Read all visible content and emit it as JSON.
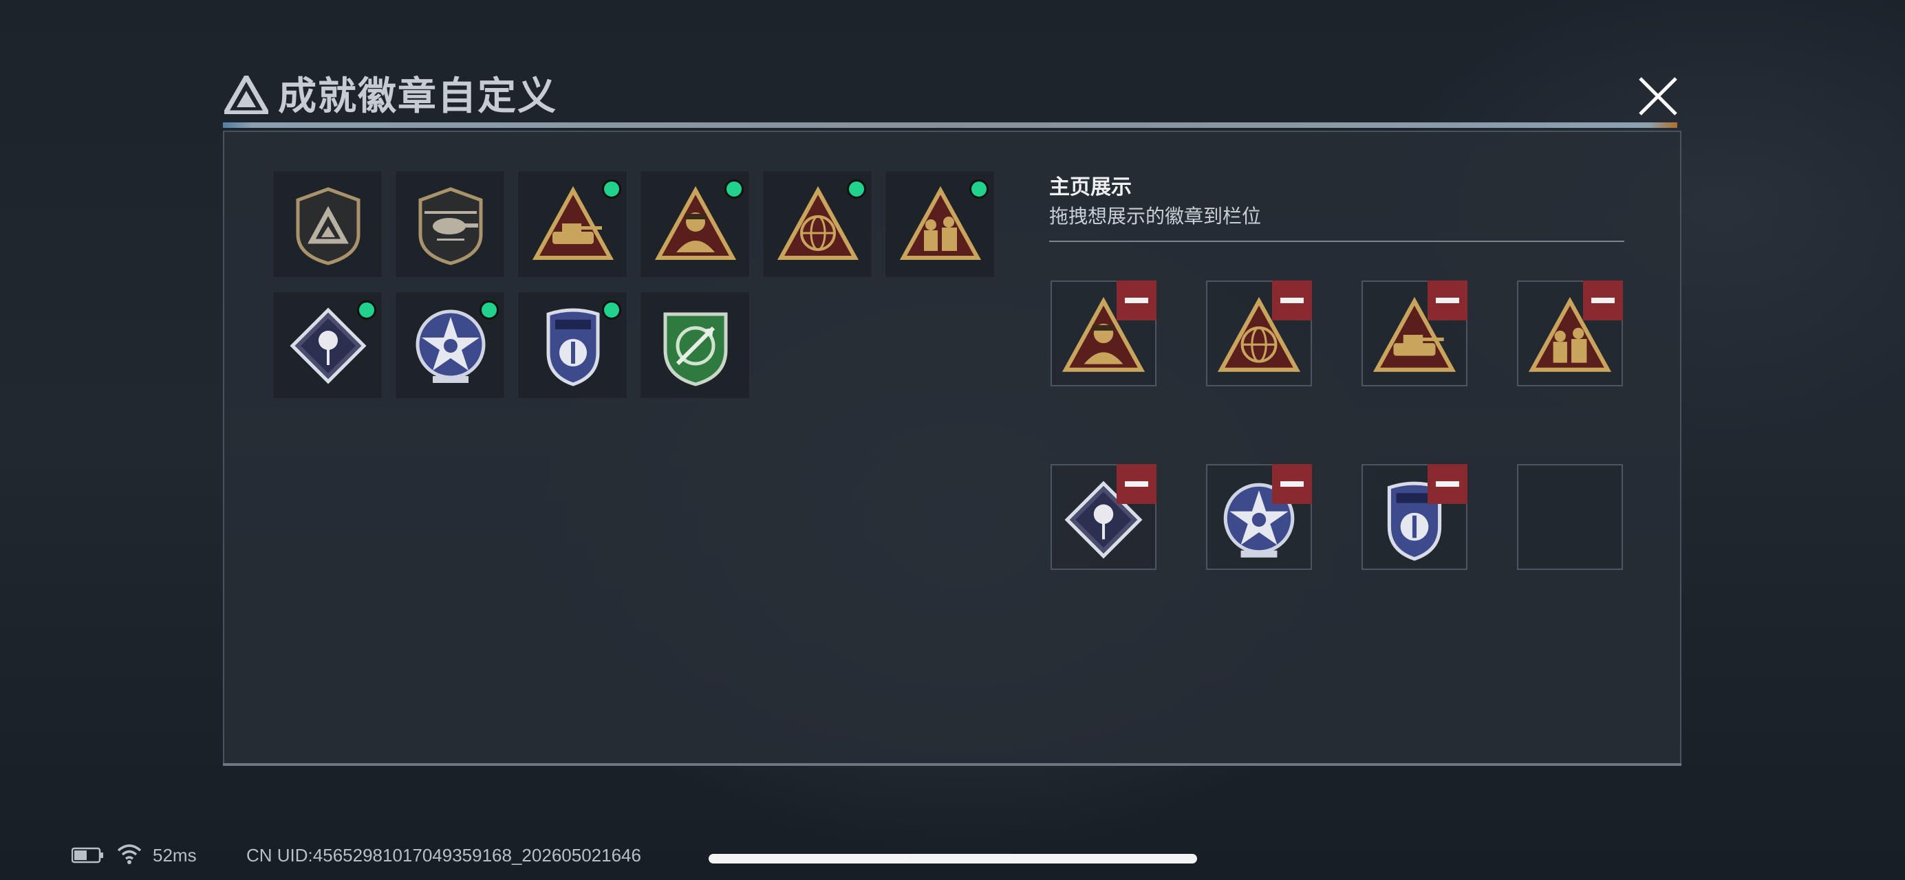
{
  "window": {
    "title": "成就徽章自定义"
  },
  "colors": {
    "accent_green": "#21d28c",
    "remove_red": "#8a2a2e",
    "badge_gold": "#c9a45c",
    "badge_blue": "#3d4a8c",
    "badge_green": "#2f7a3e"
  },
  "badge_grid": [
    {
      "icon": "basic-triangle-shield-badge-icon",
      "equipped": false
    },
    {
      "icon": "helicopter-shield-badge-icon",
      "equipped": false
    },
    {
      "icon": "vehicle-triangle-badge-icon",
      "equipped": true
    },
    {
      "icon": "soldier-triangle-badge-icon",
      "equipped": true
    },
    {
      "icon": "eri-globe-triangle-badge-icon",
      "equipped": true
    },
    {
      "icon": "squad-triangle-badge-icon",
      "equipped": true
    },
    {
      "icon": "rose-diamond-badge-icon",
      "equipped": true
    },
    {
      "icon": "star-medallion-badge-icon",
      "equipped": true
    },
    {
      "icon": "police-shield-badge-icon",
      "equipped": true
    },
    {
      "icon": "green-arrows-shield-badge-icon",
      "equipped": false
    }
  ],
  "showcase": {
    "title": "主页展示",
    "subtitle": "拖拽想展示的徽章到栏位",
    "slots": [
      {
        "icon": "soldier-triangle-badge-icon"
      },
      {
        "icon": "eri-globe-triangle-badge-icon"
      },
      {
        "icon": "vehicle-triangle-badge-icon"
      },
      {
        "icon": "squad-triangle-badge-icon"
      },
      {
        "icon": "rose-diamond-badge-icon"
      },
      {
        "icon": "star-medallion-badge-icon"
      },
      {
        "icon": "police-shield-badge-icon"
      },
      {
        "icon": "empty"
      }
    ]
  },
  "status": {
    "ping": "52ms",
    "uid": "CN UID:4565298101704935916​8_202605021646"
  }
}
